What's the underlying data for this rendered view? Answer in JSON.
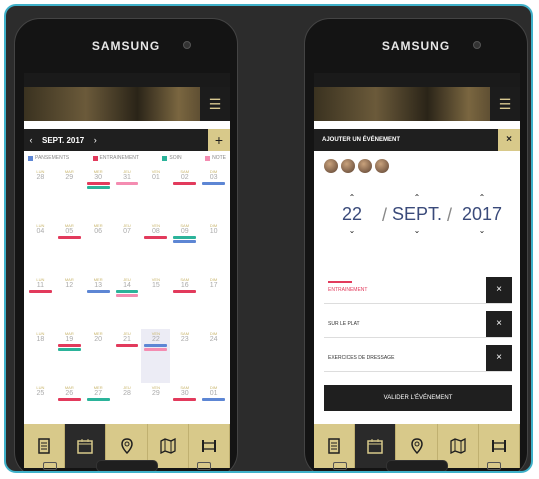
{
  "left_phone": {
    "brand": "SAMSUNG",
    "calendar": {
      "month_label": "SEPT. 2017",
      "prev_icon": "chevron-left-icon",
      "next_icon": "chevron-right-icon",
      "add_label": "+",
      "legend": [
        {
          "label": "PANSEMENTS",
          "color": "#5d86d4"
        },
        {
          "label": "ENTRAINEMENT",
          "color": "#e23a5c"
        },
        {
          "label": "SOIN",
          "color": "#2bb39a"
        },
        {
          "label": "NOTE",
          "color": "#f48cb1"
        }
      ],
      "weeks": [
        {
          "days": [
            {
              "name": "LUN",
              "date": "28",
              "bars": []
            },
            {
              "name": "MAR",
              "date": "29",
              "bars": []
            },
            {
              "name": "MER",
              "date": "30",
              "bars": [
                "#e23a5c",
                "#2bb39a"
              ]
            },
            {
              "name": "JEU",
              "date": "31",
              "bars": [
                "#f48cb1"
              ]
            },
            {
              "name": "VEN",
              "date": "01",
              "bars": []
            },
            {
              "name": "SAM",
              "date": "02",
              "bars": [
                "#e23a5c"
              ]
            },
            {
              "name": "DIM",
              "date": "03",
              "bars": [
                "#5d86d4"
              ]
            }
          ]
        },
        {
          "days": [
            {
              "name": "LUN",
              "date": "04",
              "bars": []
            },
            {
              "name": "MAR",
              "date": "05",
              "bars": [
                "#e23a5c"
              ]
            },
            {
              "name": "MER",
              "date": "06",
              "bars": []
            },
            {
              "name": "JEU",
              "date": "07",
              "bars": []
            },
            {
              "name": "VEN",
              "date": "08",
              "bars": [
                "#e23a5c"
              ]
            },
            {
              "name": "SAM",
              "date": "09",
              "bars": [
                "#2bb39a",
                "#5d86d4"
              ]
            },
            {
              "name": "DIM",
              "date": "10",
              "bars": []
            }
          ]
        },
        {
          "days": [
            {
              "name": "LUN",
              "date": "11",
              "bars": [
                "#e23a5c"
              ]
            },
            {
              "name": "MAR",
              "date": "12",
              "bars": []
            },
            {
              "name": "MER",
              "date": "13",
              "bars": [
                "#5d86d4"
              ]
            },
            {
              "name": "JEU",
              "date": "14",
              "bars": [
                "#2bb39a",
                "#f48cb1"
              ]
            },
            {
              "name": "VEN",
              "date": "15",
              "bars": []
            },
            {
              "name": "SAM",
              "date": "16",
              "bars": [
                "#e23a5c"
              ]
            },
            {
              "name": "DIM",
              "date": "17",
              "bars": []
            }
          ]
        },
        {
          "days": [
            {
              "name": "LUN",
              "date": "18",
              "bars": []
            },
            {
              "name": "MAR",
              "date": "19",
              "bars": [
                "#e23a5c",
                "#2bb39a"
              ]
            },
            {
              "name": "MER",
              "date": "20",
              "bars": []
            },
            {
              "name": "JEU",
              "date": "21",
              "bars": [
                "#e23a5c"
              ]
            },
            {
              "name": "VEN",
              "date": "22",
              "bars": [
                "#5d86d4",
                "#f48cb1"
              ]
            },
            {
              "name": "SAM",
              "date": "23",
              "bars": []
            },
            {
              "name": "DIM",
              "date": "24",
              "bars": []
            }
          ]
        },
        {
          "days": [
            {
              "name": "LUN",
              "date": "25",
              "bars": []
            },
            {
              "name": "MAR",
              "date": "26",
              "bars": [
                "#e23a5c"
              ]
            },
            {
              "name": "MER",
              "date": "27",
              "bars": [
                "#2bb39a"
              ]
            },
            {
              "name": "JEU",
              "date": "28",
              "bars": []
            },
            {
              "name": "VEN",
              "date": "29",
              "bars": []
            },
            {
              "name": "SAM",
              "date": "30",
              "bars": [
                "#e23a5c"
              ]
            },
            {
              "name": "DIM",
              "date": "01",
              "bars": [
                "#5d86d4"
              ]
            }
          ]
        }
      ]
    },
    "nav_icons": [
      "document-icon",
      "calendar-icon",
      "map-pin-icon",
      "map-icon",
      "barrier-icon"
    ]
  },
  "right_phone": {
    "brand": "SAMSUNG",
    "event_panel": {
      "title": "AJOUTER UN ÉVÉNEMENT",
      "close_label": "×",
      "day": "22",
      "month": "SEPT.",
      "year": "2017",
      "events": [
        {
          "label": "ENTRAINEMENT",
          "remove": "×"
        },
        {
          "label": "SUR LE PLAT",
          "remove": "×"
        },
        {
          "label": "EXERCICES DE DRESSAGE",
          "remove": "×"
        }
      ],
      "validate_label": "VALIDER L'ÉVÉNEMENT"
    }
  }
}
